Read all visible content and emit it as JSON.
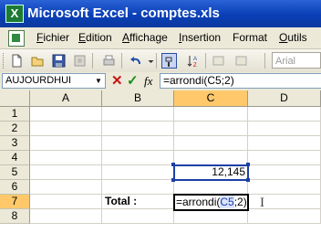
{
  "window": {
    "title": "Microsoft Excel - comptes.xls"
  },
  "menu": [
    {
      "label": "Fichier",
      "u": "F",
      "rest": "ichier"
    },
    {
      "label": "Edition",
      "u": "E",
      "rest": "dition"
    },
    {
      "label": "Affichage",
      "u": "A",
      "rest": "ffichage"
    },
    {
      "label": "Insertion",
      "u": "I",
      "rest": "nsertion"
    },
    {
      "label": "Format",
      "u": "",
      "rest": "Format"
    },
    {
      "label": "Outils",
      "u": "O",
      "rest": "utils"
    }
  ],
  "toolbar": {
    "buttons": [
      "new-icon",
      "open-icon",
      "save-icon",
      "permission-icon",
      "print-icon",
      "undo-icon",
      "undo-dropdown-icon",
      "copy-format-icon",
      "sort-icon"
    ],
    "font_name_placeholder": "Arial"
  },
  "formula_bar": {
    "name_box": "AUJOURDHUI",
    "cancel_glyph": "✕",
    "enter_glyph": "✓",
    "fx_label": "fx",
    "formula": "=arrondi(C5;2)"
  },
  "sheet": {
    "columns": [
      "A",
      "B",
      "C",
      "D"
    ],
    "active_column": "C",
    "rows": [
      "1",
      "2",
      "3",
      "4",
      "5",
      "6",
      "7",
      "8"
    ],
    "active_row": "7",
    "b7_label": "Total :",
    "c5_value": "12,145",
    "c7_edit_prefix": "=arrondi(",
    "c7_edit_ref": "C5",
    "c7_edit_suffix": ";2)"
  },
  "colors": {
    "titlebar": "#0a3fb7",
    "reference_border": "#1c3fa6",
    "header_highlight": "#ffc96b"
  }
}
